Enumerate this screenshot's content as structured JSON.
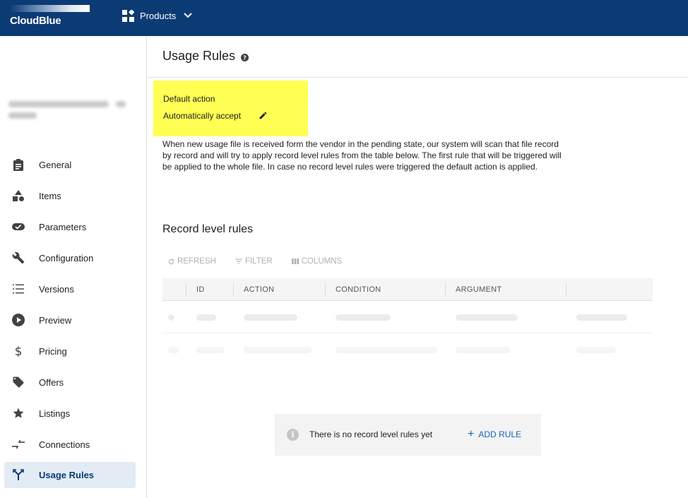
{
  "app": {
    "brand": "CloudBlue",
    "products_label": "Products"
  },
  "sidebar": {
    "items": [
      {
        "label": "General",
        "icon": "clipboard-icon"
      },
      {
        "label": "Items",
        "icon": "shapes-icon"
      },
      {
        "label": "Parameters",
        "icon": "toggle-icon"
      },
      {
        "label": "Configuration",
        "icon": "wrench-icon"
      },
      {
        "label": "Versions",
        "icon": "list-numbered-icon"
      },
      {
        "label": "Preview",
        "icon": "play-circle-icon"
      },
      {
        "label": "Pricing",
        "icon": "dollar-icon"
      },
      {
        "label": "Offers",
        "icon": "tag-icon"
      },
      {
        "label": "Listings",
        "icon": "star-icon"
      },
      {
        "label": "Connections",
        "icon": "connections-icon"
      },
      {
        "label": "Usage Rules",
        "icon": "usage-rules-icon",
        "active": true
      }
    ]
  },
  "main": {
    "title": "Usage Rules",
    "default_action_label": "Default action",
    "default_action_value": "Automatically accept",
    "description": "When new usage file is received form the vendor in the pending state, our system will scan that file record by record and will try to apply record level rules from the table below. The first rule that will be triggered will be applied to the whole file. In case no record level rules were triggered the default action is applied.",
    "section_title": "Record level rules",
    "toolbar": {
      "refresh": "REFRESH",
      "filter": "FILTER",
      "columns": "COLUMNS"
    },
    "table": {
      "columns": [
        "ID",
        "ACTION",
        "CONDITION",
        "ARGUMENT"
      ]
    },
    "empty_state": {
      "message": "There is no record level rules yet",
      "add_rule": "ADD RULE"
    }
  },
  "colors": {
    "topbar": "#0b3b74",
    "highlight": "#ffff54",
    "link": "#1565c0",
    "active_bg": "#e3ebf5"
  }
}
